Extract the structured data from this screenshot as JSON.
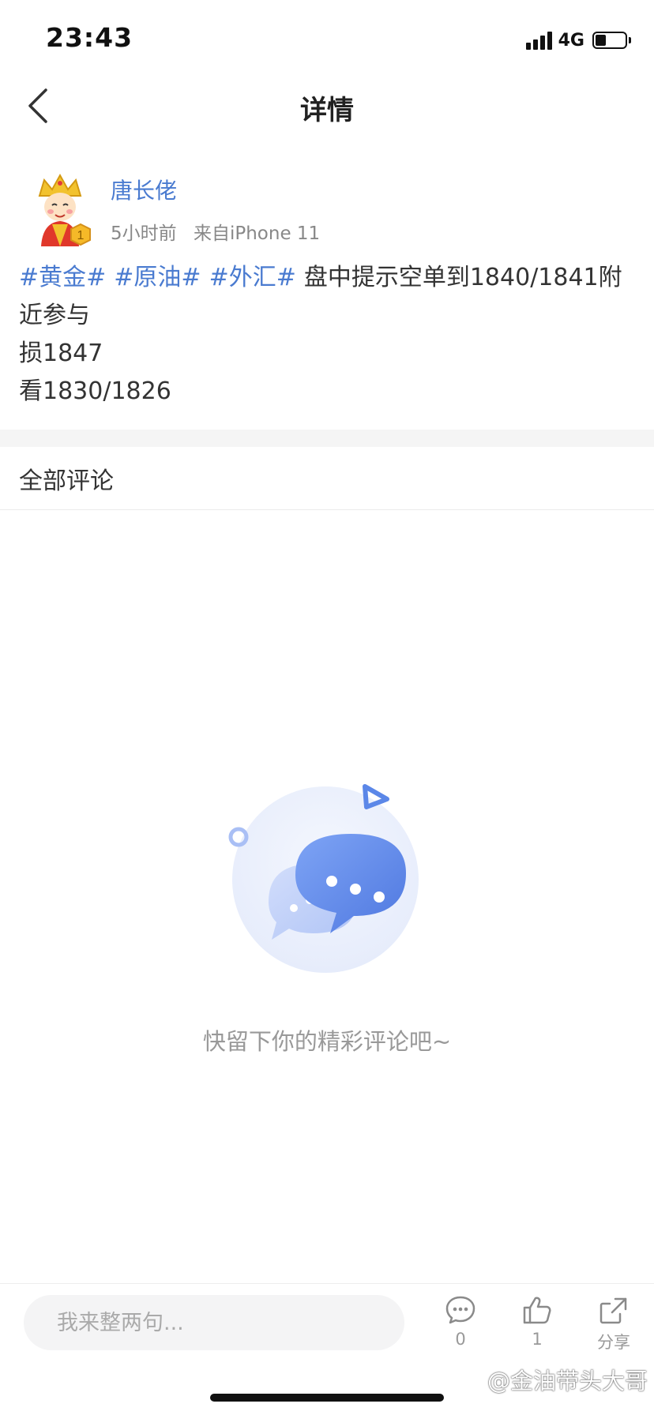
{
  "status_bar": {
    "time": "23:43",
    "network": "4G",
    "battery_level": 0.35
  },
  "nav": {
    "title": "详情",
    "back_icon": "chevron-left-icon"
  },
  "post": {
    "author": "唐长佬",
    "time_ago": "5小时前",
    "source": "来自iPhone 11",
    "hashtags": [
      "#黄金#",
      "#原油#",
      "#外汇#"
    ],
    "text_first": "盘中提示空单到1840/1841附近参与",
    "lines": [
      "损1847",
      "看1830/1826"
    ]
  },
  "comments": {
    "header": "全部评论",
    "empty_text": "快留下你的精彩评论吧~"
  },
  "bottom_bar": {
    "input_placeholder": "我来整两句...",
    "comment_count": "0",
    "like_count": "1",
    "share_label": "分享"
  },
  "watermark": "@金油带头大哥",
  "colors": {
    "link": "#4a7bd0",
    "muted": "#999999",
    "illustration_blue": "#5b87e8"
  }
}
